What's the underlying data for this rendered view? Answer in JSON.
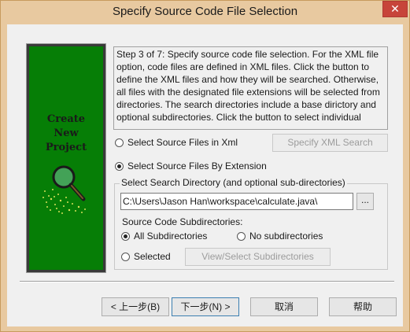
{
  "window": {
    "title": "Specify Source Code File Selection",
    "close_glyph": "✕"
  },
  "side_panel": {
    "line1": "Create",
    "line2": "New",
    "line3": "Project"
  },
  "description": "Step 3 of 7: Specify source code file selection. For the XML file option, code files are defined in XML files. Click the button to define the XML files and how they will be searched. Otherwise, all files with the designated file extensions will be selected from directories. The search directories include a base dirictory and optional subdirectories. Click the button to select individual",
  "options": {
    "xml_label": "Select Source Files in Xml",
    "xml_checked": false,
    "extension_label": "Select Source Files By Extension",
    "extension_checked": true,
    "specify_xml_button": "Specify XML Search"
  },
  "search_group": {
    "legend": "Select Search Directory (and optional sub-directories)",
    "path_value": "C:\\Users\\Jason Han\\workspace\\calculate.java\\",
    "browse_label": "...",
    "subdir_label": "Source Code Subdirectories:",
    "all_label": "All Subdirectories",
    "all_checked": true,
    "none_label": "No subdirectories",
    "none_checked": false,
    "selected_label": "Selected",
    "selected_checked": false,
    "view_select_button": "View/Select Subdirectories"
  },
  "footer": {
    "back_button": "< 上一步(B)",
    "next_button": "下一步(N) >",
    "cancel_button": "取消",
    "help_button": "帮助"
  },
  "colors": {
    "title_bar": "#e8c9a0",
    "close_button": "#c7443a",
    "panel_green": "#067e06",
    "dialog_bg": "#f0f0f0"
  }
}
